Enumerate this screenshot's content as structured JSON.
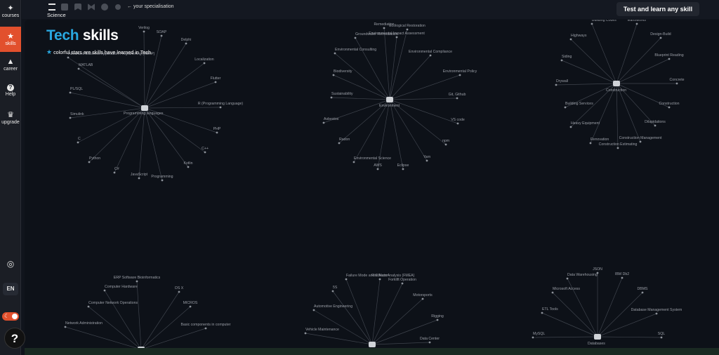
{
  "sidebar": {
    "items": [
      {
        "label": "courses",
        "icon": "sparkle-icon",
        "glyph": "✦"
      },
      {
        "label": "skills",
        "icon": "star-icon",
        "glyph": "★",
        "active": true
      },
      {
        "label": "career",
        "icon": "triangle-icon",
        "glyph": "▲"
      },
      {
        "label": "Help",
        "icon": "help-icon",
        "glyph": "?"
      },
      {
        "label": "upgrade",
        "icon": "crown-icon",
        "glyph": "♛"
      }
    ],
    "lang": "EN",
    "settings_glyph": "◎"
  },
  "topbar": {
    "breadcrumb_label": "Science",
    "hint": "← your specialisation",
    "test_button": "Test and learn any skill"
  },
  "header": {
    "title_accent": "Tech",
    "title_rest": "skills",
    "legend_star": "★",
    "legend_text": "colorful stars are skills have learned in Tech."
  },
  "help_fab": "?",
  "colors": {
    "accent": "#29a8e0",
    "active": "#e2502d"
  },
  "clusters": [
    {
      "hub": "Programming languages",
      "skills": [
        "Advanced Business Application Programming (ABAP)",
        "Verilog",
        "SOAP",
        "Delphi",
        "Localization",
        "Flutter",
        "R (Programming Language)",
        "PHP",
        "C++",
        "Kotlin",
        "Programming",
        "JavaScript",
        "C#",
        "Python",
        "C",
        "Simulink",
        "PL/SQL",
        "MATLAB"
      ]
    },
    {
      "hub": "Environment",
      "skills": [
        "Remediation",
        "Ecological Restoration",
        "Environmental Impact Assessment",
        "Environmental Compliance",
        "Environmental Policy",
        "Git, Github",
        "VS code",
        "npm",
        "Yarn",
        "Eclipse",
        "AWS",
        "Environmental Science",
        "Radon",
        "Asbestos",
        "Sustainability",
        "Biodiversity",
        "Environmental Consulting",
        "Groundwater Remediation"
      ]
    },
    {
      "hub": "Construction",
      "skills": [
        "Building Codes",
        "Earthworks",
        "Design-Build",
        "Blueprint Reading",
        "Concrete",
        "Construction",
        "Dilapidations",
        "Construction Management",
        "Construction Estimating",
        "Renovation",
        "Heavy Equipment",
        "Building Services",
        "Drywall",
        "Siding",
        "Highways"
      ]
    },
    {
      "hub": "",
      "skills": [
        "ERP Software Bioinformatics",
        "OS X",
        "MICROS",
        "Basic components in computer",
        "Network Administration",
        "Computer Network Operations",
        "Computer Hardware"
      ]
    },
    {
      "hub": "",
      "skills": [
        "Failure Mode and Effects Analysis (FMEA)",
        "Fire Alarm",
        "Forklift Operation",
        "Motorsports",
        "Rigging",
        "Data Center",
        "Vehicle Maintenance",
        "Automotive Engineering",
        "5S"
      ]
    },
    {
      "hub": "Databases",
      "skills": [
        "Data Warehousing",
        "JSON",
        "IBM Db2",
        "DBMS",
        "Database Management System",
        "SQL",
        "MySQL",
        "ETL Tools",
        "Microsoft Access"
      ]
    }
  ]
}
